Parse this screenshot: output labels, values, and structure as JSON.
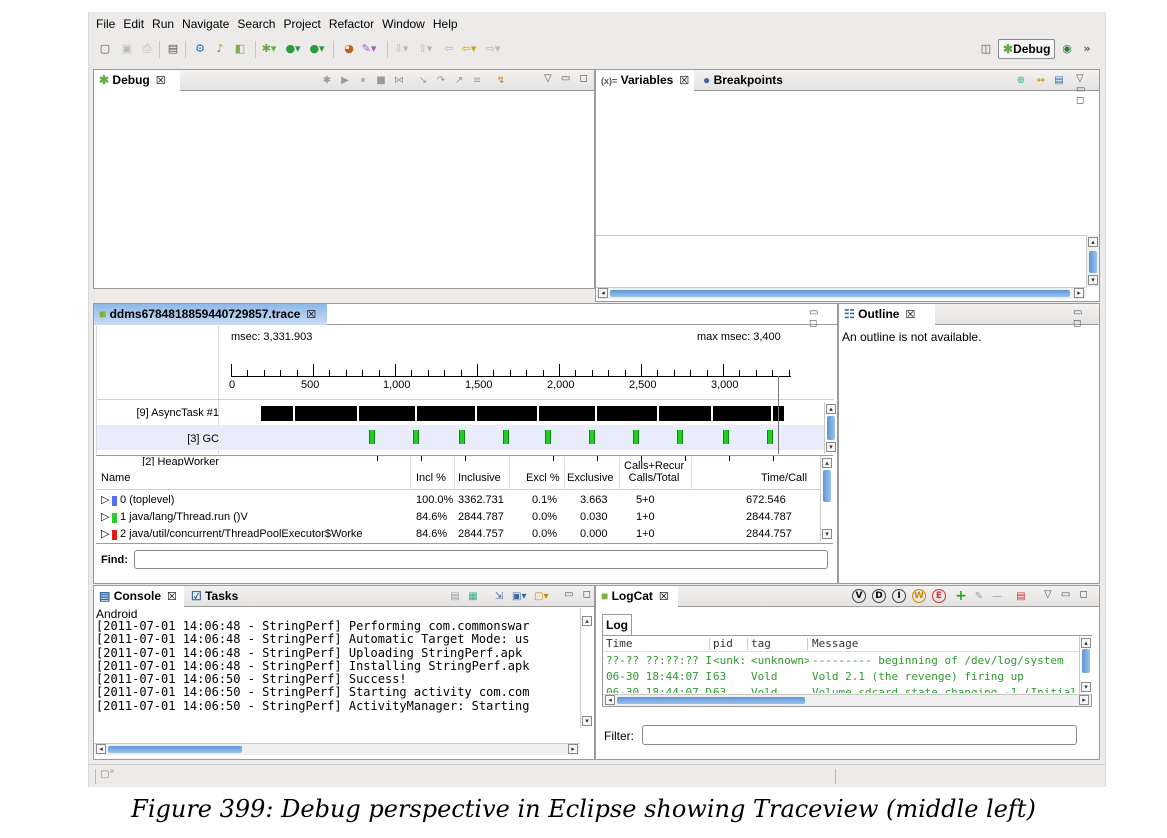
{
  "menu": [
    "File",
    "Edit",
    "Run",
    "Navigate",
    "Search",
    "Project",
    "Refactor",
    "Window",
    "Help"
  ],
  "perspective": {
    "label": "Debug"
  },
  "debug_view": {
    "tab": "Debug",
    "close": "☒"
  },
  "variables_view": {
    "tab_variables": "Variables",
    "tab_breakpoints": "Breakpoints",
    "close": "☒"
  },
  "trace_view": {
    "tab": "ddms6784818859440729857.trace",
    "close": "☒",
    "msec_label": "msec: 3,331.903",
    "max_msec_label": "max msec: 3,400",
    "ticks": [
      "0",
      "500",
      "1,000",
      "1,500",
      "2,000",
      "2,500",
      "3,000"
    ],
    "threads": [
      "[9] AsyncTask #1",
      "[3] GC",
      "[2] HeapWorker"
    ]
  },
  "profile_table": {
    "headers": {
      "name": "Name",
      "incl_pct": "Incl %",
      "inclusive": "Inclusive",
      "excl_pct": "Excl %",
      "exclusive": "Exclusive",
      "calls_1": "Calls+Recur",
      "calls_2": "Calls/Total",
      "time_call": "Time/Call"
    },
    "rows": [
      {
        "name": "0 (toplevel)",
        "color": "#5a6ef0",
        "incl_pct": "100.0%",
        "inclusive": "3362.731",
        "excl_pct": "0.1%",
        "exclusive": "3.663",
        "calls": "5+0",
        "time_call": "672.546"
      },
      {
        "name": "1 java/lang/Thread.run ()V",
        "color": "#2dcb2d",
        "incl_pct": "84.6%",
        "inclusive": "2844.787",
        "excl_pct": "0.0%",
        "exclusive": "0.030",
        "calls": "1+0",
        "time_call": "2844.787"
      },
      {
        "name": "2 java/util/concurrent/ThreadPoolExecutor$Worke",
        "color": "#e31b1b",
        "incl_pct": "84.6%",
        "inclusive": "2844.757",
        "excl_pct": "0.0%",
        "exclusive": "0.000",
        "calls": "1+0",
        "time_call": "2844.757"
      }
    ],
    "find_label": "Find:"
  },
  "outline_view": {
    "tab": "Outline",
    "close": "☒",
    "message": "An outline is not available."
  },
  "console_view": {
    "tab_console": "Console",
    "tab_tasks": "Tasks",
    "close": "☒",
    "header": "Android",
    "lines": [
      "[2011-07-01 14:06:48 - StringPerf] Performing com.commonswar",
      "[2011-07-01 14:06:48 - StringPerf] Automatic Target Mode: us",
      "[2011-07-01 14:06:48 - StringPerf] Uploading StringPerf.apk",
      "[2011-07-01 14:06:48 - StringPerf] Installing StringPerf.apk",
      "[2011-07-01 14:06:50 - StringPerf] Success!",
      "[2011-07-01 14:06:50 - StringPerf] Starting activity com.com",
      "[2011-07-01 14:06:50 - StringPerf] ActivityManager: Starting"
    ]
  },
  "logcat_view": {
    "tab": "LogCat",
    "close": "☒",
    "inner_tab": "Log",
    "level_icons": [
      "V",
      "D",
      "I",
      "W",
      "E"
    ],
    "headers": {
      "time": "Time",
      "pid": "pid",
      "tag": "tag",
      "message": "Message"
    },
    "rows": [
      {
        "time": "??-?? ??:??:?? I",
        "pid": "<unk:",
        "tag": "<unknown>",
        "message": "--------- beginning of /dev/log/system"
      },
      {
        "time": "06-30 18:44:07 I",
        "pid": "63",
        "tag": "Vold",
        "message": "Vold 2.1 (the revenge) firing up"
      },
      {
        "time": "06-30 18:44:07 D",
        "pid": "63",
        "tag": "Vold",
        "message": "Volume sdcard state changing -1 (Initial"
      }
    ],
    "filter_label": "Filter:"
  },
  "caption": "Figure 399: Debug perspective in Eclipse showing Traceview (middle left)"
}
